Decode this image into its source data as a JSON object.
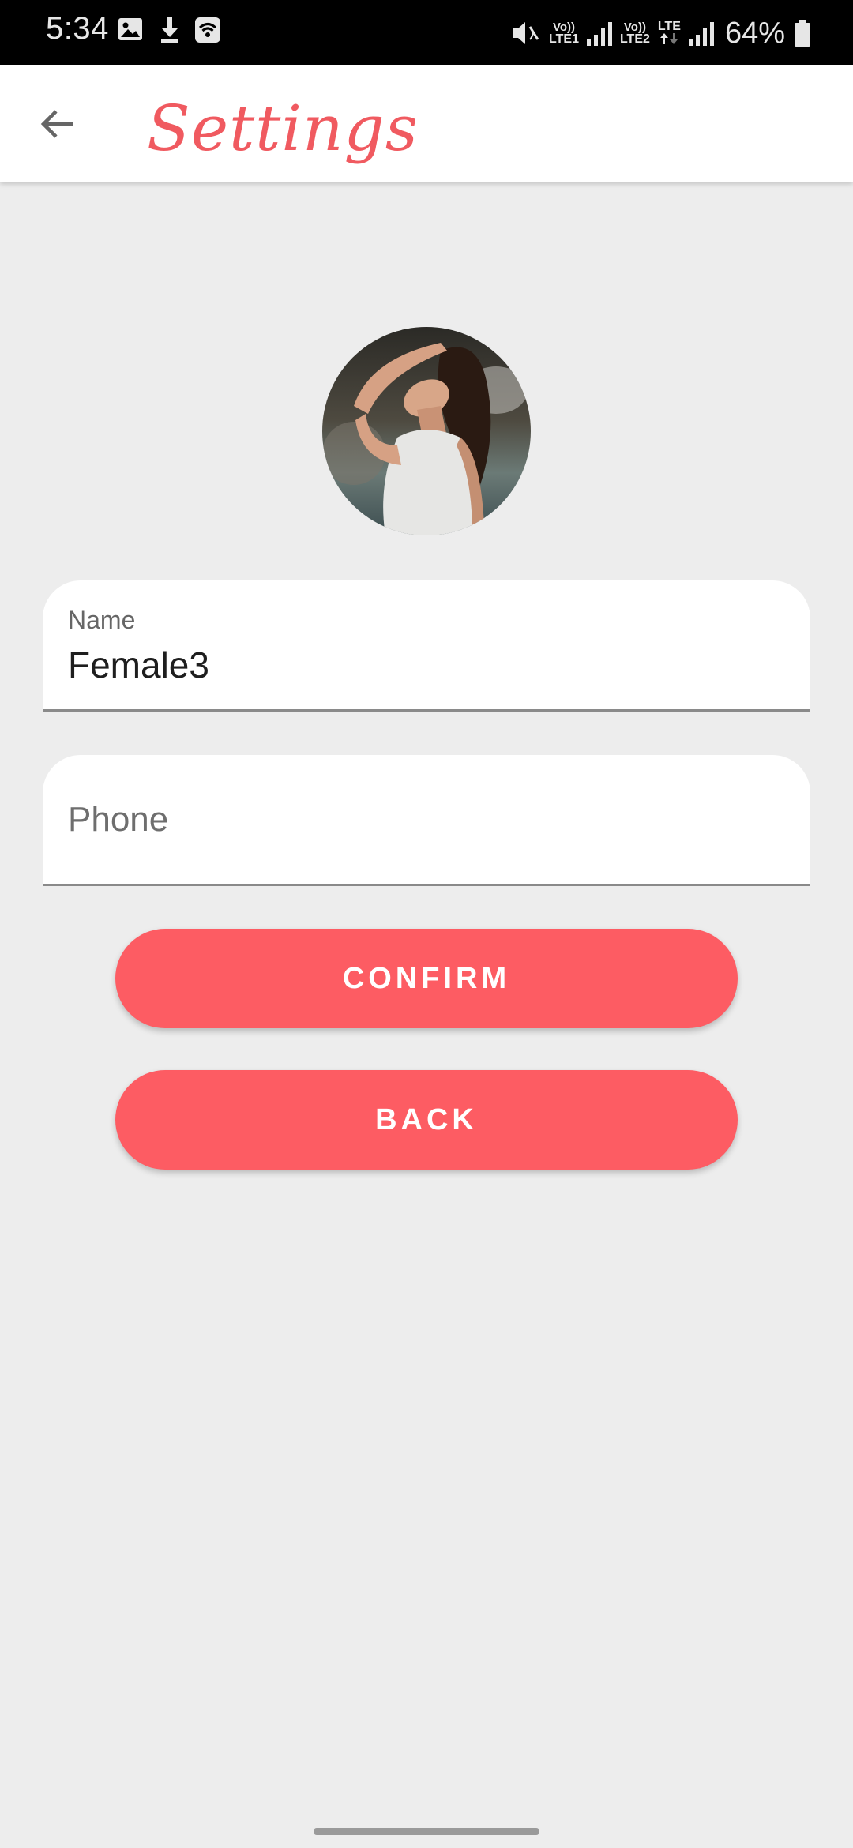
{
  "status_bar": {
    "time": "5:34",
    "volte1_top": "Vo))",
    "volte1_bottom": "LTE1",
    "volte2_top": "Vo))",
    "volte2_bottom": "LTE2",
    "lte": "LTE",
    "battery": "64%",
    "icons": [
      "gallery-icon",
      "download-icon",
      "wifi-calling-icon",
      "mute-icon",
      "signal-icon",
      "battery-icon"
    ]
  },
  "app_bar": {
    "title": "Settings",
    "back_icon": "arrow-left-icon"
  },
  "profile": {
    "avatar": "profile-photo"
  },
  "form": {
    "name": {
      "label": "Name",
      "value": "Female3"
    },
    "phone": {
      "placeholder": "Phone",
      "value": ""
    }
  },
  "buttons": {
    "confirm": "CONFIRM",
    "back": "BACK"
  },
  "colors": {
    "accent": "#fd5c63",
    "title": "#f05a60",
    "background": "#ededed"
  }
}
